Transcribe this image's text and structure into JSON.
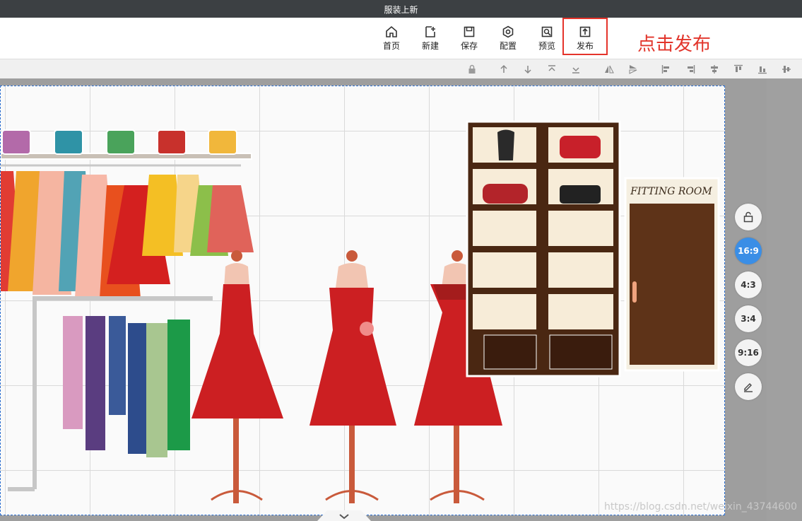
{
  "window": {
    "title": "服装上新"
  },
  "toolbar": {
    "buttons": [
      {
        "label": "首页",
        "icon": "home-icon"
      },
      {
        "label": "新建",
        "icon": "new-file-icon"
      },
      {
        "label": "保存",
        "icon": "save-icon"
      },
      {
        "label": "配置",
        "icon": "settings-icon"
      },
      {
        "label": "预览",
        "icon": "preview-icon"
      },
      {
        "label": "发布",
        "icon": "publish-icon"
      }
    ]
  },
  "annotation": {
    "text": "点击发布",
    "color": "#e2352b"
  },
  "canvas": {
    "fitting_room_sign": "FITTING ROOM"
  },
  "ratios": {
    "items": [
      "16:9",
      "4:3",
      "3:4",
      "9:16"
    ],
    "active": "16:9"
  },
  "watermark": "https://blog.csdn.net/weixin_43744600",
  "colors": {
    "accent": "#3a8ee6",
    "highlight": "#e5342b",
    "dress": "#cc1f22"
  }
}
